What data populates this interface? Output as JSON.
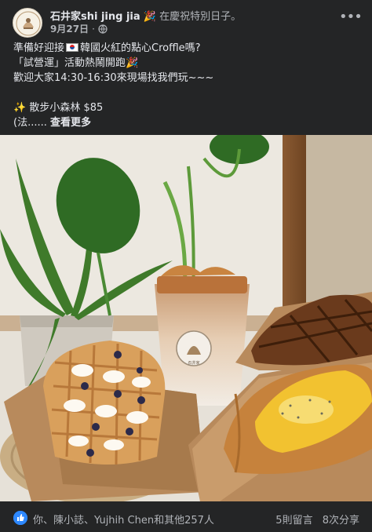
{
  "post": {
    "author": "石井家shi jing jia",
    "activity": "在慶祝特別日子。",
    "activity_emoji": "🎉",
    "date": "9月27日",
    "audience_icon": "globe-icon",
    "more_icon": "more-horizontal-icon",
    "more_label": "•••"
  },
  "text": {
    "line1_a": "準備好迎接",
    "line1_b": "韓國火紅的點心Croffle嗎?",
    "line2": "「試營運」活動熱鬧開跑",
    "line2_emoji": "🎉",
    "line3": "歡迎大家14:30-16:30來現場找我們玩~~~",
    "sparkle": "✨",
    "line4": "散步小森林 $85",
    "line5": "(法......",
    "see_more": "查看更多"
  },
  "photo": {
    "cup_logo_text": "石井家"
  },
  "footer": {
    "like_icon": "thumbs-up-icon",
    "like_glyph": "👍",
    "reactors": "你、陳小誌、Yujhih Chen和其他257人",
    "comments": "5則留言",
    "shares": "8次分享"
  },
  "colors": {
    "background": "#242526",
    "text_primary": "#e4e6eb",
    "text_secondary": "#b0b3b8",
    "like_blue": "#2d88ff"
  }
}
